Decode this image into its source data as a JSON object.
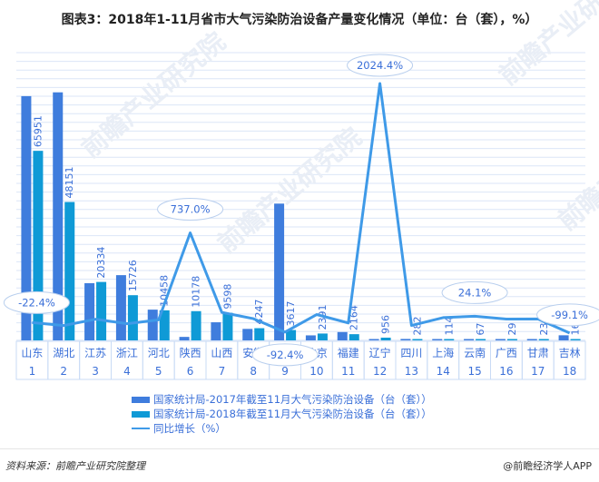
{
  "title": "图表3：2018年1-11月省市大气污染防治设备产量变化情况（单位：台（套），%）",
  "source": "资料来源：前瞻产业研究院整理",
  "credit": "@前瞻经济学人APP",
  "watermark": "前瞻产业研究院",
  "colors": {
    "bar2017": "#3f7ddd",
    "bar2018": "#0f9ad6",
    "line": "#3f9ae8",
    "grid": "#dbe6f7",
    "label": "#3a6fd8",
    "axis_cell": "#c9dbf5"
  },
  "chart_data": {
    "type": "bar",
    "title": "图表3：2018年1-11月省市大气污染防治设备产量变化情况（单位：台（套），%）",
    "xlabel": "",
    "ylabel": "",
    "categories": [
      "山东",
      "湖北",
      "江苏",
      "浙江",
      "河北",
      "陕西",
      "山西",
      "安徽",
      "河南",
      "北京",
      "福建",
      "辽宁",
      "四川",
      "上海",
      "云南",
      "广西",
      "甘肃",
      "吉林"
    ],
    "ranks": [
      "1",
      "2",
      "3",
      "4",
      "5",
      "6",
      "7",
      "8",
      "9",
      "10",
      "11",
      "12",
      "13",
      "14",
      "15",
      "16",
      "17",
      "18"
    ],
    "grid": true,
    "legend_position": "bottom",
    "ylim_bars": [
      0,
      90000
    ],
    "ylim_line": [
      -500,
      2500
    ],
    "series": [
      {
        "name": "国家统计局-2017年截至11月大气污染防治设备（台（套））",
        "kind": "bar",
        "values": [
          84980,
          86300,
          19900,
          22700,
          10700,
          1215,
          6300,
          4000,
          47590,
          1750,
          2900,
          45,
          500,
          100,
          54,
          28,
          22,
          1778
        ]
      },
      {
        "name": "国家统计局-2018年截至11月大气污染防治设备（台（套））",
        "kind": "bar",
        "values": [
          65951,
          48151,
          20334,
          15726,
          10458,
          10178,
          9598,
          4247,
          3617,
          2391,
          2164,
          956,
          282,
          114,
          67,
          29,
          23,
          16
        ]
      },
      {
        "name": "同比增长（%）",
        "kind": "line",
        "values": [
          -22.4,
          -44.2,
          2.2,
          -30.7,
          -2.3,
          737.0,
          52.3,
          6.2,
          -92.4,
          36.6,
          -25.4,
          2024.4,
          -43.6,
          14.0,
          24.1,
          3.6,
          4.5,
          -99.1
        ]
      }
    ],
    "annotations": [
      {
        "index": 0,
        "text": "-22.4%"
      },
      {
        "index": 5,
        "text": "737.0%"
      },
      {
        "index": 8,
        "text": "-92.4%"
      },
      {
        "index": 11,
        "text": "2024.4%"
      },
      {
        "index": 14,
        "text": "24.1%"
      },
      {
        "index": 17,
        "text": "-99.1%"
      }
    ],
    "bar_labels_2018": [
      "65951",
      "48151",
      "20334",
      "15726",
      "10458",
      "10178",
      "9598",
      "4247",
      "3617",
      "2391",
      "2164",
      "956",
      "282",
      "114",
      "67",
      "29",
      "23",
      "16"
    ]
  }
}
